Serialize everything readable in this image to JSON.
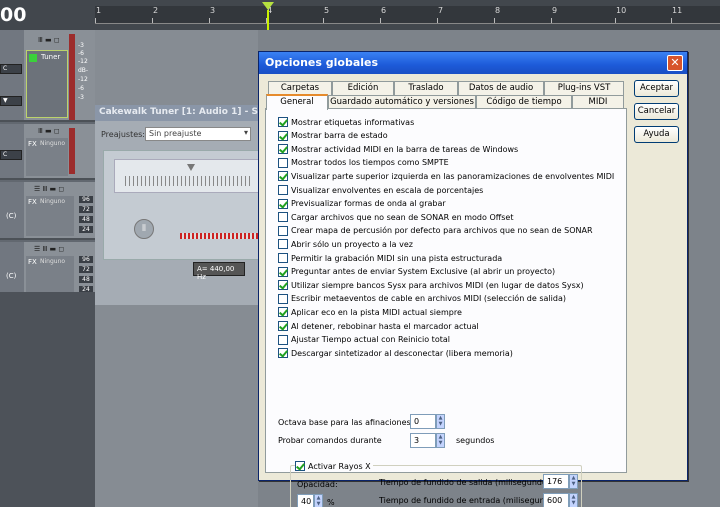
{
  "timeline": {
    "timecode": "00",
    "ruler_labels": [
      "1",
      "2",
      "3",
      "4",
      "5",
      "6",
      "7",
      "8",
      "9",
      "10",
      "11"
    ]
  },
  "tracks": {
    "track1": {
      "plugin_label": "Tuner",
      "scale_labels": [
        "-3",
        "-6",
        "-12",
        "dB-",
        "-12",
        "-6",
        "-3"
      ]
    },
    "track2": {
      "fx_label": "FX",
      "plugin_label": "Ninguno"
    },
    "track3": {
      "fx_label": "FX",
      "plugin_label": "Ninguno",
      "numbers": [
        "96",
        "72",
        "48",
        "24"
      ],
      "pan_label": "(C)"
    },
    "track4": {
      "fx_label": "FX",
      "plugin_label": "Ninguno",
      "numbers": [
        "96",
        "72",
        "48",
        "24"
      ],
      "pan_label": "(C)"
    }
  },
  "tuner": {
    "title": "Cakewalk Tuner [1: Audio 1] - S",
    "preset_label": "Preajustes:",
    "preset_value": "Sin preajuste",
    "freq_readout": "A= 440,00 Hz"
  },
  "dialog": {
    "title": "Opciones globales",
    "tabs_back": [
      "Carpetas",
      "Edición",
      "Traslado",
      "Datos de audio",
      "Plug-ins VST"
    ],
    "tabs_front": [
      "General",
      "Guardado automático y versiones",
      "Código de tiempo",
      "MIDI"
    ],
    "buttons": {
      "accept": "Aceptar",
      "cancel": "Cancelar",
      "help": "Ayuda"
    },
    "options": [
      {
        "label": "Mostrar etiquetas informativas",
        "checked": true
      },
      {
        "label": "Mostrar barra de estado",
        "checked": true
      },
      {
        "label": "Mostrar actividad MIDI en la barra de tareas de Windows",
        "checked": true
      },
      {
        "label": "Mostrar todos los tiempos como SMPTE",
        "checked": false
      },
      {
        "label": "Visualizar parte superior izquierda en las panoramizaciones de envolventes MIDI",
        "checked": true
      },
      {
        "label": "Visualizar envolventes en escala de porcentajes",
        "checked": false
      },
      {
        "label": "Previsualizar formas de onda al grabar",
        "checked": true
      },
      {
        "label": "Cargar archivos que no sean de SONAR en modo Offset",
        "checked": false
      },
      {
        "label": "Crear mapa de percusión por defecto para archivos que no sean de SONAR",
        "checked": false
      },
      {
        "label": "Abrir sólo un proyecto a la vez",
        "checked": false
      },
      {
        "label": "Permitir la grabación MIDI sin una pista estructurada",
        "checked": false
      },
      {
        "label": "Preguntar antes de enviar System Exclusive (al abrir un proyecto)",
        "checked": true
      },
      {
        "label": "Utilizar siempre bancos Sysx para archivos MIDI (en lugar de datos Sysx)",
        "checked": true
      },
      {
        "label": "Escribir metaeventos de cable en archivos MIDI (selección de salida)",
        "checked": false
      },
      {
        "label": "Aplicar eco en la pista MIDI actual siempre",
        "checked": true
      },
      {
        "label": "Al detener, rebobinar hasta el marcador actual",
        "checked": true
      },
      {
        "label": "Ajustar Tiempo actual con Reinicio total",
        "checked": false
      },
      {
        "label": "Descargar sintetizador al desconectar (libera memoria)",
        "checked": true
      }
    ],
    "octave": {
      "label": "Octava base para las afinaciones:",
      "value": "0"
    },
    "probe": {
      "label": "Probar comandos durante",
      "value": "3",
      "unit": "segundos"
    },
    "xray": {
      "checkbox_label": "Activar Rayos X",
      "checked": true,
      "opacity_label": "Opacidad:",
      "opacity_value": "40",
      "opacity_unit": "%",
      "fade_out_label": "Tiempo de fundido de salida (milisegundos):",
      "fade_out_value": "176",
      "fade_in_label": "Tiempo de fundido de entrada (milisegundos):",
      "fade_in_value": "600"
    }
  }
}
